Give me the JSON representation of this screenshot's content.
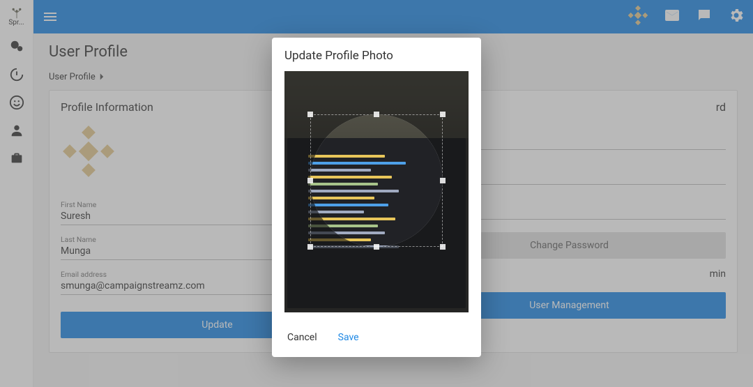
{
  "brand_short": "Spr...",
  "header": {},
  "sidebar": {},
  "page": {
    "title": "User Profile",
    "breadcrumb": "User Profile"
  },
  "profile": {
    "section_title": "Profile Information",
    "first_name_label": "First Name",
    "first_name": "Suresh",
    "last_name_label": "Last Name",
    "last_name": "Munga",
    "email_label": "Email address",
    "email": "smunga@campaignstreamz.com",
    "update_label": "Update"
  },
  "password": {
    "section_title_suffix": "rd",
    "change_label": "Change Password"
  },
  "role": {
    "value_suffix": "min",
    "manage_label": "User Management"
  },
  "dialog": {
    "title": "Update Profile Photo",
    "cancel": "Cancel",
    "save": "Save"
  },
  "colors": {
    "primary": "#1e88e5",
    "brand_accent": "#e3c98e"
  }
}
